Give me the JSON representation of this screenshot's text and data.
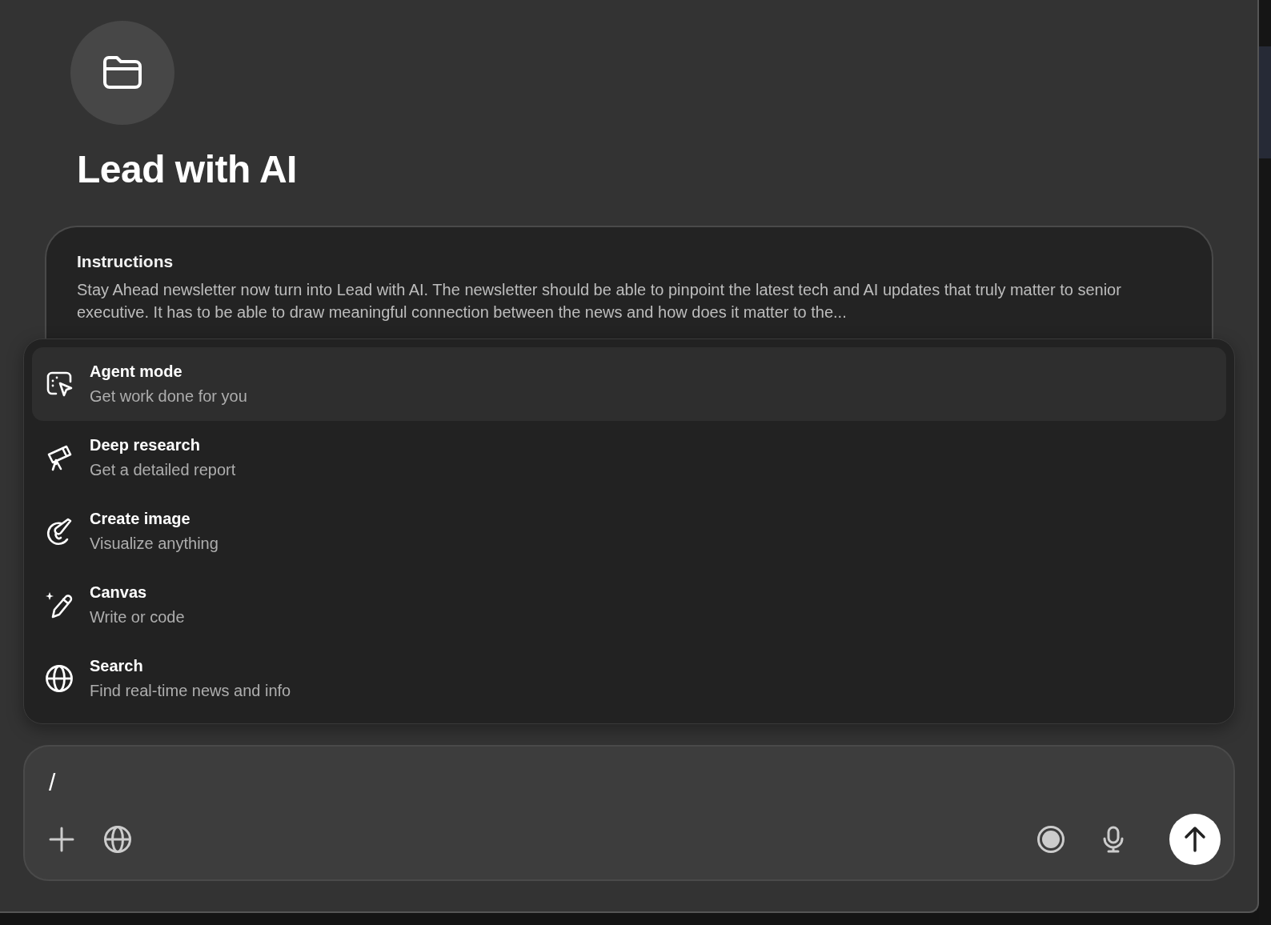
{
  "project": {
    "title": "Lead with AI"
  },
  "instructions": {
    "heading": "Instructions",
    "text": "Stay Ahead newsletter now turn into Lead with AI. The newsletter should be able to pinpoint the latest tech and AI updates that truly matter to senior executive. It has to be able to draw meaningful connection between the news and how does it matter to the..."
  },
  "menu": {
    "items": [
      {
        "kind": "agent",
        "label": "Agent mode",
        "description": "Get work done for you",
        "selected": true
      },
      {
        "kind": "research",
        "label": "Deep research",
        "description": "Get a detailed report",
        "selected": false
      },
      {
        "kind": "image",
        "label": "Create image",
        "description": "Visualize anything",
        "selected": false
      },
      {
        "kind": "canvas",
        "label": "Canvas",
        "description": "Write or code",
        "selected": false
      },
      {
        "kind": "search",
        "label": "Search",
        "description": "Find real-time news and info",
        "selected": false
      }
    ]
  },
  "composer": {
    "value": "/"
  }
}
